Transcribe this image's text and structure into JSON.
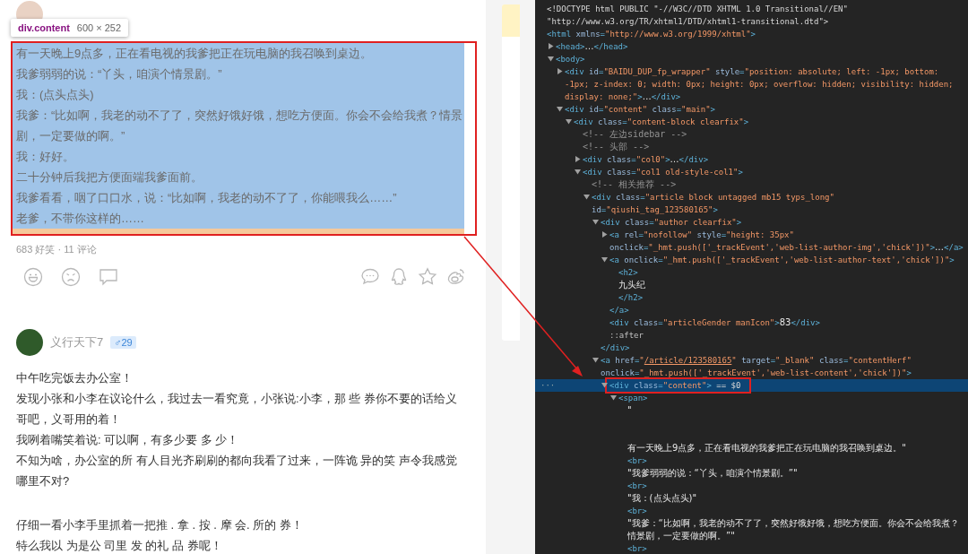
{
  "inspector_tooltip": {
    "selector": "div.content",
    "size": "600 × 252"
  },
  "posts": [
    {
      "highlighted": true,
      "sections": [
        {
          "paragraphs": [
            "有一天晚上9点多，正在看电视的我爹把正在玩电脑的我召唤到桌边。",
            "我爹弱弱的说：“丫头，咱演个情景剧。”",
            "我：(点头点头)",
            "我爹：“比如啊，我老的动不了了，突然好饿好饿，想吃方便面。你会不会给我煮？情景剧，一定要做的啊。”",
            "我：好好。",
            "二十分钟后我把方便面端我爹面前。",
            "我爹看看，咽了口口水，说：“比如啊，我老的动不了了，你能喂我么……”",
            "老爹，不带你这样的……"
          ]
        }
      ],
      "stats": "683 好笑 · 11 评论"
    },
    {
      "highlighted": false,
      "author": {
        "name": "义行天下7",
        "badge": "♂29"
      },
      "sections": [
        {
          "paragraphs": [
            "中午吃完饭去办公室！",
            "发现小张和小李在议论什么，我过去一看究竟，小张说:小李，那 些 券你不要的话给义哥吧，义哥用的着！",
            "我咧着嘴笑着说: 可以啊，有多少要 多 少！",
            "不知为啥，办公室的所 有人目光齐刷刷的都向我看了过来，一阵诡 异的笑 声令我感觉哪里不对?"
          ]
        },
        {
          "paragraphs": [
            "仔细一看小李手里抓着一把推 . 拿 . 按 . 摩 会. 所的 券！",
            "特么我以 为是公 司里 发 的礼 品 券呢！"
          ]
        }
      ]
    }
  ],
  "devtools": {
    "selected_marker": "···",
    "nodes": [
      {
        "selected": false,
        "tokens": [
          {
            "kind": "plain",
            "text": "<!DOCTYPE html PUBLIC \"-//W3C//DTD XHTML 1.0 Transitional//EN\" \"http://www.w3.org/TR/xhtml1/DTD/xhtml1-transitional.dtd\">"
          }
        ]
      },
      {
        "selected": false,
        "tokens": [
          {
            "kind": "tag",
            "text": "<html"
          },
          {
            "kind": "attr",
            "text": " xmlns"
          },
          {
            "kind": "tag",
            "text": "="
          },
          {
            "kind": "value",
            "text": "\"http://www.w3.org/1999/xhtml\""
          },
          {
            "kind": "tag",
            "text": ">"
          }
        ],
        "children": [
          {
            "selected": false,
            "expanded": false,
            "tokens": [
              {
                "kind": "tag",
                "text": "<head>"
              },
              {
                "kind": "text",
                "text": "…"
              },
              {
                "kind": "tag",
                "text": "</head>"
              }
            ]
          },
          {
            "selected": false,
            "expanded": true,
            "tokens": [
              {
                "kind": "tag",
                "text": "<body>"
              }
            ],
            "children": [
              {
                "selected": false,
                "expanded": false,
                "tokens": [
                  {
                    "kind": "tag",
                    "text": "<div"
                  },
                  {
                    "kind": "attr",
                    "text": " id"
                  },
                  {
                    "kind": "tag",
                    "text": "="
                  },
                  {
                    "kind": "value",
                    "text": "\"BAIDU_DUP_fp_wrapper\""
                  },
                  {
                    "kind": "attr",
                    "text": " style"
                  },
                  {
                    "kind": "tag",
                    "text": "="
                  },
                  {
                    "kind": "value",
                    "text": "\"position: absolute; left: -1px; bottom: -1px; z-index: 0; width: 0px; height: 0px; overflow: hidden; visibility: hidden; display: none;\""
                  },
                  {
                    "kind": "tag",
                    "text": ">"
                  },
                  {
                    "kind": "text",
                    "text": "…"
                  },
                  {
                    "kind": "tag",
                    "text": "</div>"
                  }
                ]
              },
              {
                "selected": false,
                "expanded": true,
                "tokens": [
                  {
                    "kind": "tag",
                    "text": "<div"
                  },
                  {
                    "kind": "attr",
                    "text": " id"
                  },
                  {
                    "kind": "tag",
                    "text": "="
                  },
                  {
                    "kind": "value",
                    "text": "\"content\""
                  },
                  {
                    "kind": "attr",
                    "text": " class"
                  },
                  {
                    "kind": "tag",
                    "text": "="
                  },
                  {
                    "kind": "value",
                    "text": "\"main\""
                  },
                  {
                    "kind": "tag",
                    "text": ">"
                  }
                ],
                "children": [
                  {
                    "selected": false,
                    "expanded": true,
                    "tokens": [
                      {
                        "kind": "tag",
                        "text": "<div"
                      },
                      {
                        "kind": "attr",
                        "text": " class"
                      },
                      {
                        "kind": "tag",
                        "text": "="
                      },
                      {
                        "kind": "value",
                        "text": "\"content-block clearfix\""
                      },
                      {
                        "kind": "tag",
                        "text": ">"
                      }
                    ],
                    "children": [
                      {
                        "selected": false,
                        "tokens": [
                          {
                            "kind": "comment",
                            "text": "<!-- 左边sidebar -->"
                          }
                        ]
                      },
                      {
                        "selected": false,
                        "tokens": [
                          {
                            "kind": "comment",
                            "text": "<!-- 头部 -->"
                          }
                        ]
                      },
                      {
                        "selected": false,
                        "expanded": false,
                        "tokens": [
                          {
                            "kind": "tag",
                            "text": "<div"
                          },
                          {
                            "kind": "attr",
                            "text": " class"
                          },
                          {
                            "kind": "tag",
                            "text": "="
                          },
                          {
                            "kind": "value",
                            "text": "\"col0\""
                          },
                          {
                            "kind": "tag",
                            "text": ">"
                          },
                          {
                            "kind": "text",
                            "text": "…"
                          },
                          {
                            "kind": "tag",
                            "text": "</div>"
                          }
                        ]
                      },
                      {
                        "selected": false,
                        "expanded": true,
                        "tokens": [
                          {
                            "kind": "tag",
                            "text": "<div"
                          },
                          {
                            "kind": "attr",
                            "text": " class"
                          },
                          {
                            "kind": "tag",
                            "text": "="
                          },
                          {
                            "kind": "value",
                            "text": "\"col1 old-style-col1\""
                          },
                          {
                            "kind": "tag",
                            "text": ">"
                          }
                        ],
                        "children": [
                          {
                            "selected": false,
                            "tokens": [
                              {
                                "kind": "comment",
                                "text": "<!-- 相关推荐 -->"
                              }
                            ]
                          },
                          {
                            "selected": false,
                            "expanded": true,
                            "tokens": [
                              {
                                "kind": "tag",
                                "text": "<div"
                              },
                              {
                                "kind": "attr",
                                "text": " class"
                              },
                              {
                                "kind": "tag",
                                "text": "="
                              },
                              {
                                "kind": "value",
                                "text": "\"article block untagged mb15 typs_long\""
                              },
                              {
                                "kind": "attr",
                                "text": " id"
                              },
                              {
                                "kind": "tag",
                                "text": "="
                              },
                              {
                                "kind": "value",
                                "text": "\"qiushi_tag_123580165\""
                              },
                              {
                                "kind": "tag",
                                "text": ">"
                              }
                            ],
                            "children": [
                              {
                                "selected": false,
                                "expanded": true,
                                "tokens": [
                                  {
                                    "kind": "tag",
                                    "text": "<div"
                                  },
                                  {
                                    "kind": "attr",
                                    "text": " class"
                                  },
                                  {
                                    "kind": "tag",
                                    "text": "="
                                  },
                                  {
                                    "kind": "value",
                                    "text": "\"author clearfix\""
                                  },
                                  {
                                    "kind": "tag",
                                    "text": ">"
                                  }
                                ],
                                "close": "</div>",
                                "children": [
                                  {
                                    "selected": false,
                                    "expanded": false,
                                    "tokens": [
                                      {
                                        "kind": "tag",
                                        "text": "<a"
                                      },
                                      {
                                        "kind": "attr",
                                        "text": " rel"
                                      },
                                      {
                                        "kind": "tag",
                                        "text": "="
                                      },
                                      {
                                        "kind": "value",
                                        "text": "\"nofollow\""
                                      },
                                      {
                                        "kind": "attr",
                                        "text": " style"
                                      },
                                      {
                                        "kind": "tag",
                                        "text": "="
                                      },
                                      {
                                        "kind": "value",
                                        "text": "\"height: 35px\""
                                      },
                                      {
                                        "kind": "attr",
                                        "text": " onclick"
                                      },
                                      {
                                        "kind": "tag",
                                        "text": "="
                                      },
                                      {
                                        "kind": "value",
                                        "text": "\"_hmt.push(['_trackEvent','web-list-author-img','chick'])\""
                                      },
                                      {
                                        "kind": "tag",
                                        "text": ">"
                                      },
                                      {
                                        "kind": "text",
                                        "text": "…"
                                      },
                                      {
                                        "kind": "tag",
                                        "text": "</a>"
                                      }
                                    ]
                                  },
                                  {
                                    "selected": false,
                                    "expanded": true,
                                    "tokens": [
                                      {
                                        "kind": "tag",
                                        "text": "<a"
                                      },
                                      {
                                        "kind": "attr",
                                        "text": " onclick"
                                      },
                                      {
                                        "kind": "tag",
                                        "text": "="
                                      },
                                      {
                                        "kind": "value",
                                        "text": "\"_hmt.push(['_trackEvent','web-list-author-text','chick'])\""
                                      },
                                      {
                                        "kind": "tag",
                                        "text": ">"
                                      }
                                    ],
                                    "close": "</a>",
                                    "children": [
                                      {
                                        "selected": false,
                                        "tokens": [
                                          {
                                            "kind": "tag",
                                            "text": "<h2>"
                                          }
                                        ]
                                      },
                                      {
                                        "selected": false,
                                        "tokens": [
                                          {
                                            "kind": "text",
                                            "text": "九头纪"
                                          }
                                        ]
                                      },
                                      {
                                        "selected": false,
                                        "tokens": [
                                          {
                                            "kind": "tag",
                                            "text": "</h2>"
                                          }
                                        ]
                                      }
                                    ]
                                  },
                                  {
                                    "selected": false,
                                    "tokens": [
                                      {
                                        "kind": "tag",
                                        "text": "<div"
                                      },
                                      {
                                        "kind": "attr",
                                        "text": " class"
                                      },
                                      {
                                        "kind": "tag",
                                        "text": "="
                                      },
                                      {
                                        "kind": "value",
                                        "text": "\"articleGender manIcon\""
                                      },
                                      {
                                        "kind": "tag",
                                        "text": ">"
                                      },
                                      {
                                        "kind": "text",
                                        "text": "83"
                                      },
                                      {
                                        "kind": "tag",
                                        "text": "</div>"
                                      }
                                    ]
                                  },
                                  {
                                    "selected": false,
                                    "tokens": [
                                      {
                                        "kind": "pseudo",
                                        "text": "::after"
                                      }
                                    ]
                                  }
                                ]
                              },
                              {
                                "selected": false,
                                "expanded": true,
                                "tokens": [
                                  {
                                    "kind": "tag",
                                    "text": "<a"
                                  },
                                  {
                                    "kind": "attr",
                                    "text": " href"
                                  },
                                  {
                                    "kind": "tag",
                                    "text": "="
                                  },
                                  {
                                    "kind": "value",
                                    "text": "\""
                                  },
                                  {
                                    "kind": "link",
                                    "text": "/article/123580165"
                                  },
                                  {
                                    "kind": "value",
                                    "text": "\""
                                  },
                                  {
                                    "kind": "attr",
                                    "text": " target"
                                  },
                                  {
                                    "kind": "tag",
                                    "text": "="
                                  },
                                  {
                                    "kind": "value",
                                    "text": "\"_blank\""
                                  },
                                  {
                                    "kind": "attr",
                                    "text": " class"
                                  },
                                  {
                                    "kind": "tag",
                                    "text": "="
                                  },
                                  {
                                    "kind": "value",
                                    "text": "\"contentHerf\""
                                  },
                                  {
                                    "kind": "attr",
                                    "text": " onclick"
                                  },
                                  {
                                    "kind": "tag",
                                    "text": "="
                                  },
                                  {
                                    "kind": "value",
                                    "text": "\"_hmt.push(['_trackEvent','web-list-content','chick'])\""
                                  },
                                  {
                                    "kind": "tag",
                                    "text": ">"
                                  }
                                ],
                                "children": [
                                  {
                                    "selected": true,
                                    "boxed": true,
                                    "expanded": true,
                                    "tokens": [
                                      {
                                        "kind": "tag",
                                        "text": "<div"
                                      },
                                      {
                                        "kind": "attr",
                                        "text": " class"
                                      },
                                      {
                                        "kind": "tag",
                                        "text": "="
                                      },
                                      {
                                        "kind": "value",
                                        "text": "\"content\""
                                      },
                                      {
                                        "kind": "tag",
                                        "text": ">"
                                      },
                                      {
                                        "kind": "console",
                                        "text": " == $0"
                                      }
                                    ],
                                    "children": [
                                      {
                                        "selected": false,
                                        "expanded": true,
                                        "tokens": [
                                          {
                                            "kind": "tag",
                                            "text": "<span>"
                                          }
                                        ],
                                        "children": [
                                          {
                                            "selected": false,
                                            "tokens": [
                                              {
                                                "kind": "text",
                                                "text": "\"\n\n\n有一天晚上9点多，正在看电视的我爹把正在玩电脑的我召唤到桌边。\""
                                              }
                                            ]
                                          },
                                          {
                                            "selected": false,
                                            "tokens": [
                                              {
                                                "kind": "tag",
                                                "text": "<br>"
                                              }
                                            ]
                                          },
                                          {
                                            "selected": false,
                                            "tokens": [
                                              {
                                                "kind": "text",
                                                "text": "\"我爹弱弱的说：“丫头，咱演个情景剧。”\""
                                              }
                                            ]
                                          },
                                          {
                                            "selected": false,
                                            "tokens": [
                                              {
                                                "kind": "tag",
                                                "text": "<br>"
                                              }
                                            ]
                                          },
                                          {
                                            "selected": false,
                                            "tokens": [
                                              {
                                                "kind": "text",
                                                "text": "\"我：(点头点头)\""
                                              }
                                            ]
                                          },
                                          {
                                            "selected": false,
                                            "tokens": [
                                              {
                                                "kind": "tag",
                                                "text": "<br>"
                                              }
                                            ]
                                          },
                                          {
                                            "selected": false,
                                            "tokens": [
                                              {
                                                "kind": "text",
                                                "text": "\"我爹：“比如啊，我老的动不了了，突然好饿好饿，想吃方便面。你会不会给我煮？情景剧，一定要做的啊。”\""
                                              }
                                            ]
                                          },
                                          {
                                            "selected": false,
                                            "tokens": [
                                              {
                                                "kind": "tag",
                                                "text": "<br>"
                                              }
                                            ]
                                          }
                                        ]
                                      }
                                    ]
                                  }
                                ]
                              }
                            ]
                          }
                        ]
                      }
                    ]
                  }
                ]
              }
            ]
          }
        ]
      }
    ]
  }
}
